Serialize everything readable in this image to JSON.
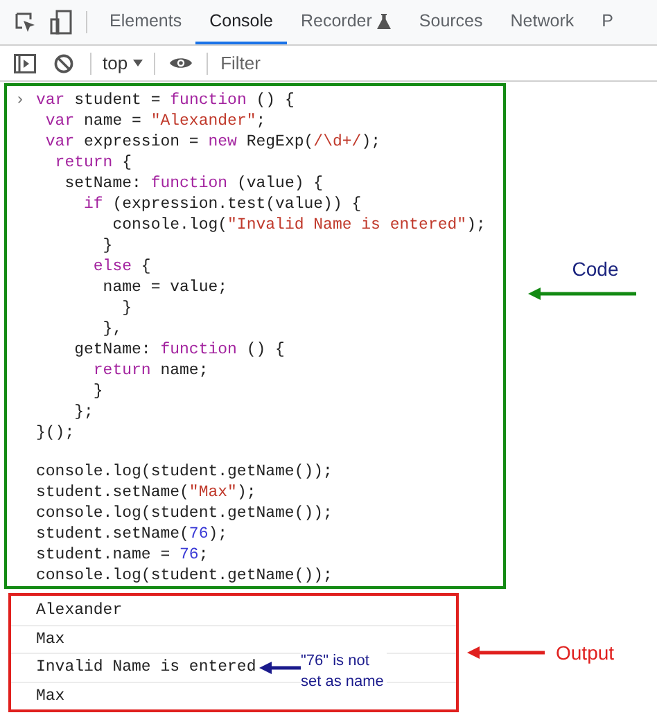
{
  "tabs": [
    {
      "label": "Elements",
      "selected": false,
      "experimental": false
    },
    {
      "label": "Console",
      "selected": true,
      "experimental": false
    },
    {
      "label": "Recorder",
      "selected": false,
      "experimental": true
    },
    {
      "label": "Sources",
      "selected": false,
      "experimental": false
    },
    {
      "label": "Network",
      "selected": false,
      "experimental": false
    },
    {
      "label": "P",
      "selected": false,
      "experimental": false
    }
  ],
  "context_selector": {
    "value": "top"
  },
  "filter": {
    "placeholder": "Filter"
  },
  "code": {
    "prompt": "›",
    "label": "Code",
    "lines": [
      {
        "kind": "code",
        "tokens": [
          {
            "text": "var",
            "kind": "keyword"
          },
          {
            "text": " student = ",
            "kind": "plain"
          },
          {
            "text": "function",
            "kind": "keyword"
          },
          {
            "text": " () {",
            "kind": "plain"
          }
        ]
      },
      {
        "kind": "code",
        "tokens": [
          {
            "text": " var",
            "kind": "keyword"
          },
          {
            "text": " name = ",
            "kind": "plain"
          },
          {
            "text": "\"Alexander\"",
            "kind": "string"
          },
          {
            "text": ";",
            "kind": "plain"
          }
        ]
      },
      {
        "kind": "code",
        "tokens": [
          {
            "text": " var",
            "kind": "keyword"
          },
          {
            "text": " expression = ",
            "kind": "plain"
          },
          {
            "text": "new",
            "kind": "keyword"
          },
          {
            "text": " RegExp(",
            "kind": "plain"
          },
          {
            "text": "/\\d+/",
            "kind": "string"
          },
          {
            "text": ");",
            "kind": "plain"
          }
        ]
      },
      {
        "kind": "code",
        "tokens": [
          {
            "text": "  return",
            "kind": "keyword"
          },
          {
            "text": " {",
            "kind": "plain"
          }
        ]
      },
      {
        "kind": "code",
        "tokens": [
          {
            "text": "   setName: ",
            "kind": "plain"
          },
          {
            "text": "function",
            "kind": "keyword"
          },
          {
            "text": " (value) {",
            "kind": "plain"
          }
        ]
      },
      {
        "kind": "code",
        "tokens": [
          {
            "text": "     if",
            "kind": "keyword"
          },
          {
            "text": " (expression.test(value)) {",
            "kind": "plain"
          }
        ]
      },
      {
        "kind": "code",
        "tokens": [
          {
            "text": "        console.log(",
            "kind": "plain"
          },
          {
            "text": "\"Invalid Name is entered\"",
            "kind": "string"
          },
          {
            "text": ");",
            "kind": "plain"
          }
        ]
      },
      {
        "kind": "code",
        "tokens": [
          {
            "text": "       }",
            "kind": "plain"
          }
        ]
      },
      {
        "kind": "code",
        "tokens": [
          {
            "text": "      else",
            "kind": "keyword"
          },
          {
            "text": " {",
            "kind": "plain"
          }
        ]
      },
      {
        "kind": "code",
        "tokens": [
          {
            "text": "       name = value;",
            "kind": "plain"
          }
        ]
      },
      {
        "kind": "code",
        "tokens": [
          {
            "text": "         }",
            "kind": "plain"
          }
        ]
      },
      {
        "kind": "code",
        "tokens": [
          {
            "text": "       },",
            "kind": "plain"
          }
        ]
      },
      {
        "kind": "code",
        "tokens": [
          {
            "text": "    getName: ",
            "kind": "plain"
          },
          {
            "text": "function",
            "kind": "keyword"
          },
          {
            "text": " () {",
            "kind": "plain"
          }
        ]
      },
      {
        "kind": "code",
        "tokens": [
          {
            "text": "      return",
            "kind": "keyword"
          },
          {
            "text": " name;",
            "kind": "plain"
          }
        ]
      },
      {
        "kind": "code",
        "tokens": [
          {
            "text": "      }",
            "kind": "plain"
          }
        ]
      },
      {
        "kind": "code",
        "tokens": [
          {
            "text": "    };",
            "kind": "plain"
          }
        ]
      },
      {
        "kind": "code",
        "tokens": [
          {
            "text": "}();",
            "kind": "plain"
          }
        ]
      },
      {
        "kind": "blank"
      },
      {
        "kind": "code",
        "tokens": [
          {
            "text": "console.log(student.getName());",
            "kind": "plain"
          }
        ]
      },
      {
        "kind": "code",
        "tokens": [
          {
            "text": "student.setName(",
            "kind": "plain"
          },
          {
            "text": "\"Max\"",
            "kind": "string"
          },
          {
            "text": ");",
            "kind": "plain"
          }
        ]
      },
      {
        "kind": "code",
        "tokens": [
          {
            "text": "console.log(student.getName());",
            "kind": "plain"
          }
        ]
      },
      {
        "kind": "code",
        "tokens": [
          {
            "text": "student.setName(",
            "kind": "plain"
          },
          {
            "text": "76",
            "kind": "number"
          },
          {
            "text": ");",
            "kind": "plain"
          }
        ]
      },
      {
        "kind": "code",
        "tokens": [
          {
            "text": "student.name = ",
            "kind": "plain"
          },
          {
            "text": "76",
            "kind": "number"
          },
          {
            "text": ";",
            "kind": "plain"
          }
        ]
      },
      {
        "kind": "code",
        "tokens": [
          {
            "text": "console.log(student.getName());",
            "kind": "plain"
          }
        ]
      }
    ]
  },
  "output": {
    "label": "Output",
    "lines": [
      {
        "text": "Alexander"
      },
      {
        "text": "Max"
      },
      {
        "text": "Invalid Name is entered",
        "note": "\"76\" is not set as name"
      },
      {
        "text": "Max"
      }
    ]
  }
}
